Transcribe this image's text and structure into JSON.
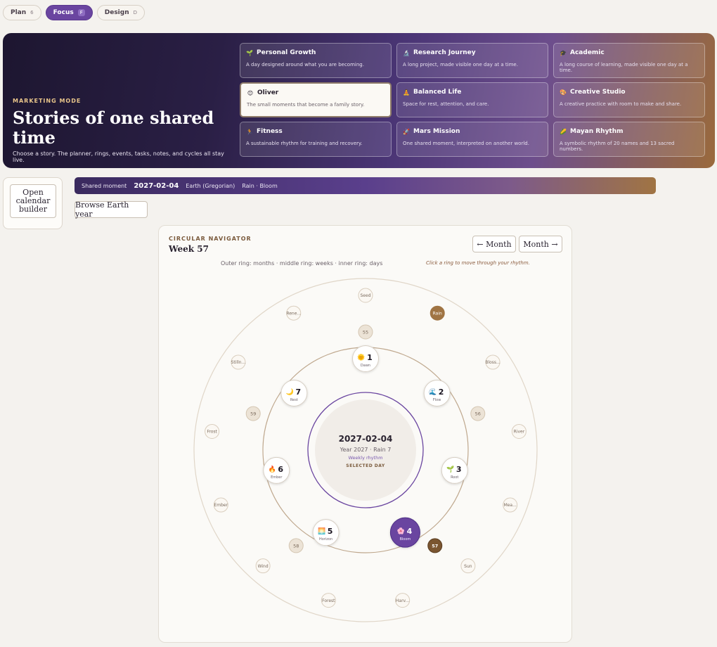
{
  "modes": [
    {
      "label": "Plan",
      "count": "6",
      "active": false
    },
    {
      "label": "Focus",
      "count": "F",
      "active": true
    },
    {
      "label": "Design",
      "count": "D",
      "active": false
    }
  ],
  "hero": {
    "eyebrow": "MARKETING MODE",
    "title": "Stories of one shared time",
    "description": "Choose a story. The planner, rings, events, tasks, notes, and cycles all stay live."
  },
  "stories": [
    {
      "icon": "🌱",
      "title": "Personal Growth",
      "desc": "A day designed around what you are becoming."
    },
    {
      "icon": "🔬",
      "title": "Research Journey",
      "desc": "A long project, made visible one day at a time."
    },
    {
      "icon": "🎓",
      "title": "Academic",
      "desc": "A long course of learning, made visible one day at a time."
    },
    {
      "icon": "😊",
      "title": "Oliver",
      "desc": "The small moments that become a family story.",
      "selected": true
    },
    {
      "icon": "🧘",
      "title": "Balanced Life",
      "desc": "Space for rest, attention, and care."
    },
    {
      "icon": "🎨",
      "title": "Creative Studio",
      "desc": "A creative practice with room to make and share."
    },
    {
      "icon": "🏃",
      "title": "Fitness",
      "desc": "A sustainable rhythm for training and recovery."
    },
    {
      "icon": "🚀",
      "title": "Mars Mission",
      "desc": "One shared moment, interpreted on another world."
    },
    {
      "icon": "🌽",
      "title": "Mayan Rhythm",
      "desc": "A symbolic rhythm of 20 names and 13 sacred numbers."
    }
  ],
  "builder": {
    "label": "Open calendar builder"
  },
  "moment": {
    "label": "Shared moment",
    "date": "2027-02-04",
    "calendar": "Earth (Gregorian)",
    "season": "Rain · Bloom"
  },
  "browse": {
    "label": "Browse Earth year"
  },
  "navigator": {
    "eyebrow": "CIRCULAR NAVIGATOR",
    "title": "Week 57",
    "prev_label": "← Month",
    "next_label": "Month →",
    "caption": "Outer ring: months · middle ring: weeks · inner ring: days",
    "hint": "Click a ring to move through your rhythm.",
    "center": {
      "date": "2027-02-04",
      "sub": "Year 2027 · Rain 7",
      "rhythm": "Weekly rhythm",
      "state": "SELECTED DAY"
    },
    "months": [
      "Seed",
      "Rain",
      "Bloss...",
      "River",
      "Mea...",
      "Sun",
      "Harv...",
      "Forest",
      "Wind",
      "Ember",
      "Frost",
      "Stilln...",
      "Rene..."
    ],
    "active_month": "Rain",
    "weeks": [
      "55",
      "56",
      "57",
      "58",
      "59"
    ],
    "active_week": "57",
    "days": [
      {
        "num": "1",
        "name": "Dawn",
        "icon": "🌞"
      },
      {
        "num": "2",
        "name": "Flow",
        "icon": "🌊"
      },
      {
        "num": "3",
        "name": "Root",
        "icon": "🌱"
      },
      {
        "num": "4",
        "name": "Bloom",
        "icon": "🌸"
      },
      {
        "num": "5",
        "name": "Horizon",
        "icon": "🌅"
      },
      {
        "num": "6",
        "name": "Ember",
        "icon": "🔥"
      },
      {
        "num": "7",
        "name": "Rest",
        "icon": "🌙"
      }
    ],
    "active_day": "4",
    "colors": {
      "accent": "#6a45a0",
      "month_active": "#a07443",
      "week_active": "#7a5530"
    }
  }
}
